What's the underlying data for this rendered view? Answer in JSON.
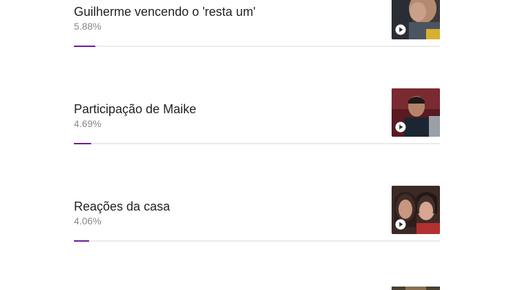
{
  "poll": {
    "items": [
      {
        "title": "Guilherme vencendo o 'resta um'",
        "percent_label": "5.88%",
        "percent": 5.88
      },
      {
        "title": "Participação de Maike",
        "percent_label": "4.69%",
        "percent": 4.69
      },
      {
        "title": "Reações da casa",
        "percent_label": "4.06%",
        "percent": 4.06
      }
    ],
    "accent_color": "#6a1b9a",
    "thumb_icon": "play-icon"
  }
}
